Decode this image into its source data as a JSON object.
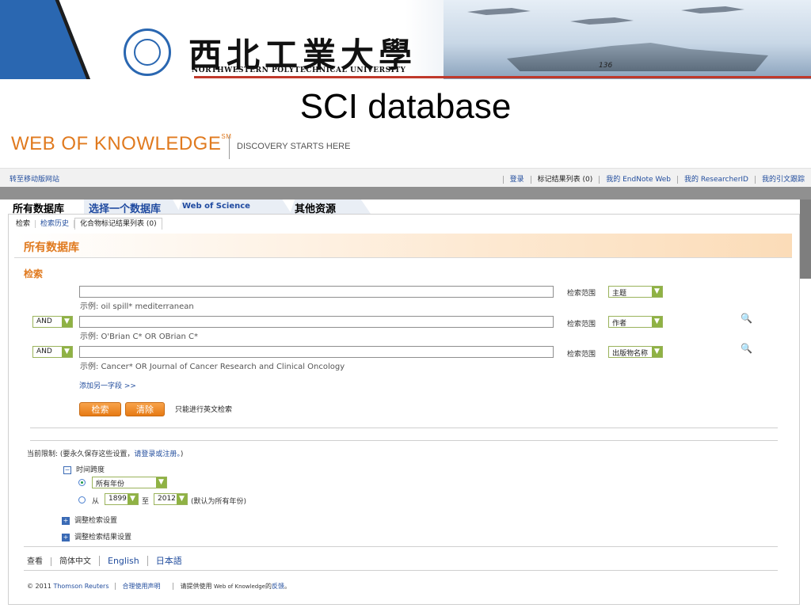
{
  "banner": {
    "university_cn": "西北工業大學",
    "university_en": "NORTHWESTERN POLYTECHNICAL UNIVERSITY",
    "ship_number": "136"
  },
  "slide_title": "SCI database",
  "wok": {
    "logo": "WEB OF KNOWLEDGE",
    "logo_mark": "SM",
    "tagline": "DISCOVERY STARTS HERE"
  },
  "topbar": {
    "mobile": "转至移动版网站",
    "login": "登录",
    "marked_list": "标记结果列表 (0)",
    "endnote": "我的 EndNote Web",
    "researcherid": "我的 ResearcherID",
    "citation": "我的引文跟踪"
  },
  "tabs": {
    "all_databases": "所有数据库",
    "select_db": "选择一个数据库",
    "wos": "Web of Science",
    "other": "其他资源"
  },
  "subtabs": {
    "search": "检索",
    "history": "检索历史",
    "compound_list": "化合物标记结果列表 (0)"
  },
  "section_title": "所有数据库",
  "search_heading": "检索",
  "rows": [
    {
      "example": "示例: oil spill* mediterranean",
      "scope_label": "检索范围",
      "scope": "主题"
    },
    {
      "op": "AND",
      "example": "示例: O'Brian C* OR OBrian C*",
      "scope_label": "检索范围",
      "scope": "作者"
    },
    {
      "op": "AND",
      "example": "示例: Cancer* OR Journal of Cancer Research and Clinical Oncology",
      "scope_label": "检索范围",
      "scope": "出版物名称"
    }
  ],
  "add_field": "添加另一字段 >>",
  "buttons": {
    "search": "检索",
    "clear": "清除"
  },
  "english_only": "只能进行英文检索",
  "limits": {
    "prefix": "当前限制: (要永久保存这些设置，",
    "link": "请登录或注册。",
    "suffix": ")",
    "timespan": "时间跨度",
    "all_years": "所有年份",
    "from": "从",
    "from_year": "1899",
    "to": "至",
    "to_year": "2012",
    "default_note": "(默认为所有年份)",
    "adjust_search": "调整检索设置",
    "adjust_results": "调整检索结果设置"
  },
  "lang": {
    "view": "查看",
    "zh": "简体中文",
    "en": "English",
    "ja": "日本語"
  },
  "footer": {
    "copyright": "© 2011",
    "tr": "Thomson Reuters",
    "terms": "合理使用声明",
    "feedback_prefix": "请提供使用",
    "feedback_product": "Web of Knowledge",
    "feedback_mid": "的",
    "feedback_link": "反馈",
    "feedback_end": "。"
  },
  "colors": {
    "accent_orange": "#e07a1f",
    "link_blue": "#234e9e",
    "select_green": "#8fb244"
  }
}
